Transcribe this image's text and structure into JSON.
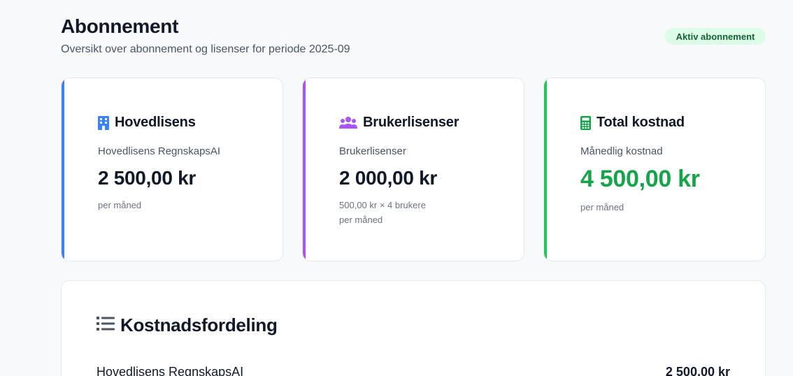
{
  "header": {
    "title": "Abonnement",
    "subtitle": "Oversikt over abonnement og lisenser for periode 2025-09"
  },
  "status": {
    "label": "Aktiv abonnement"
  },
  "cards": {
    "main": {
      "title": "Hovedlisens",
      "subtitle": "Hovedlisens RegnskapsAI",
      "amount": "2 500,00 kr",
      "note": "per måned",
      "icon": "building-icon"
    },
    "users": {
      "title": "Brukerlisenser",
      "subtitle": "Brukerlisenser",
      "amount": "2 000,00 kr",
      "detail": "500,00 kr × 4 brukere",
      "note": "per måned",
      "icon": "users-icon"
    },
    "total": {
      "title": "Total kostnad",
      "subtitle": "Månedlig kostnad",
      "amount": "4 500,00 kr",
      "note": "per måned",
      "icon": "calculator-icon"
    }
  },
  "breakdown": {
    "title": "Kostnadsfordeling",
    "icon": "list-icon",
    "rows": [
      {
        "label": "Hovedlisens RegnskapsAI",
        "amount": "2 500,00 kr"
      }
    ]
  },
  "colors": {
    "main_accent": "#3b82f6",
    "users_accent": "#a855f7",
    "total_accent": "#22c55e",
    "badge_bg": "#dcfce7",
    "badge_text": "#166534"
  }
}
